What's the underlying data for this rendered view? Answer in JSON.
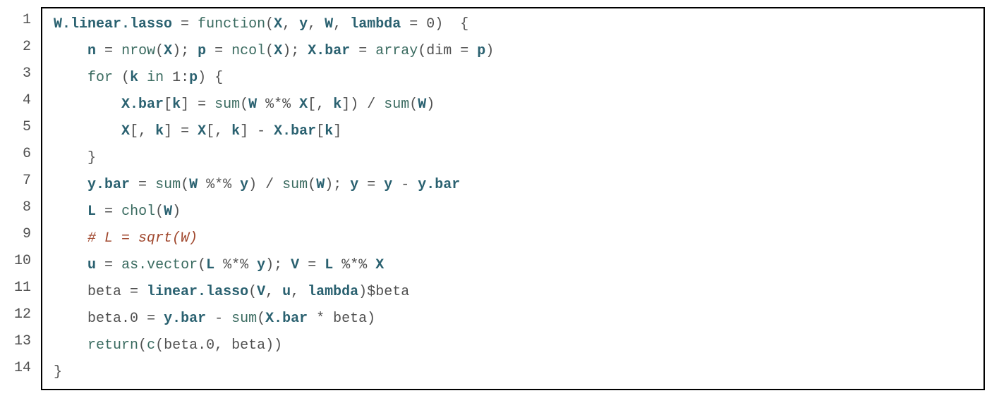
{
  "lineNumbers": [
    "1",
    "2",
    "3",
    "4",
    "5",
    "6",
    "7",
    "8",
    "9",
    "10",
    "11",
    "12",
    "13",
    "14"
  ],
  "code": {
    "l1": {
      "a": "W.linear.lasso",
      "b": " = ",
      "c": "function",
      "d": "(",
      "e": "X",
      "f": ", ",
      "g": "y",
      "h": ", ",
      "i": "W",
      "j": ", ",
      "k": "lambda",
      "l": " = ",
      "m": "0",
      "n": ")  {"
    },
    "l2": {
      "a": "    ",
      "b": "n",
      "c": " = ",
      "d": "nrow",
      "e": "(",
      "f": "X",
      "g": "); ",
      "h": "p",
      "i": " = ",
      "j": "ncol",
      "k": "(",
      "l": "X",
      "m": "); ",
      "n": "X.bar",
      "o": " = ",
      "p": "array",
      "q": "(dim = ",
      "r": "p",
      "s": ")"
    },
    "l3": {
      "a": "    ",
      "b": "for",
      "c": " (",
      "d": "k",
      "e": " in ",
      "f": "1",
      "g": ":",
      "h": "p",
      "i": ") {"
    },
    "l4": {
      "a": "        ",
      "b": "X.bar",
      "c": "[",
      "d": "k",
      "e": "] = ",
      "f": "sum",
      "g": "(",
      "h": "W",
      "i": " %*% ",
      "j": "X",
      "k": "[, ",
      "l": "k",
      "m": "]) / ",
      "n": "sum",
      "o": "(",
      "p": "W",
      "q": ")"
    },
    "l5": {
      "a": "        ",
      "b": "X",
      "c": "[, ",
      "d": "k",
      "e": "] = ",
      "f": "X",
      "g": "[, ",
      "h": "k",
      "i": "] - ",
      "j": "X.bar",
      "k": "[",
      "l": "k",
      "m": "]"
    },
    "l6": {
      "a": "    }"
    },
    "l7": {
      "a": "    ",
      "b": "y.bar",
      "c": " = ",
      "d": "sum",
      "e": "(",
      "f": "W",
      "g": " %*% ",
      "h": "y",
      "i": ") / ",
      "j": "sum",
      "k": "(",
      "l": "W",
      "m": "); ",
      "n": "y",
      "o": " = ",
      "p": "y",
      "q": " - ",
      "r": "y.bar"
    },
    "l8": {
      "a": "    ",
      "b": "L",
      "c": " = ",
      "d": "chol",
      "e": "(",
      "f": "W",
      "g": ")"
    },
    "l9": {
      "a": "    ",
      "b": "# L = sqrt(W)"
    },
    "l10": {
      "a": "    ",
      "b": "u",
      "c": " = ",
      "d": "as.vector",
      "e": "(",
      "f": "L",
      "g": " %*% ",
      "h": "y",
      "i": "); ",
      "j": "V",
      "k": " = ",
      "l": "L",
      "m": " %*% ",
      "n": "X"
    },
    "l11": {
      "a": "    beta = ",
      "b": "linear.lasso",
      "c": "(",
      "d": "V",
      "e": ", ",
      "f": "u",
      "g": ", ",
      "h": "lambda",
      "i": ")",
      "j": "$",
      "k": "beta"
    },
    "l12": {
      "a": "    beta.",
      "b": "0",
      "c": " = ",
      "d": "y.bar",
      "e": " - ",
      "f": "sum",
      "g": "(",
      "h": "X.bar",
      "i": " * beta)"
    },
    "l13": {
      "a": "    ",
      "b": "return",
      "c": "(",
      "d": "c",
      "e": "(beta.",
      "f": "0",
      "g": ", beta))"
    },
    "l14": {
      "a": "}"
    }
  }
}
